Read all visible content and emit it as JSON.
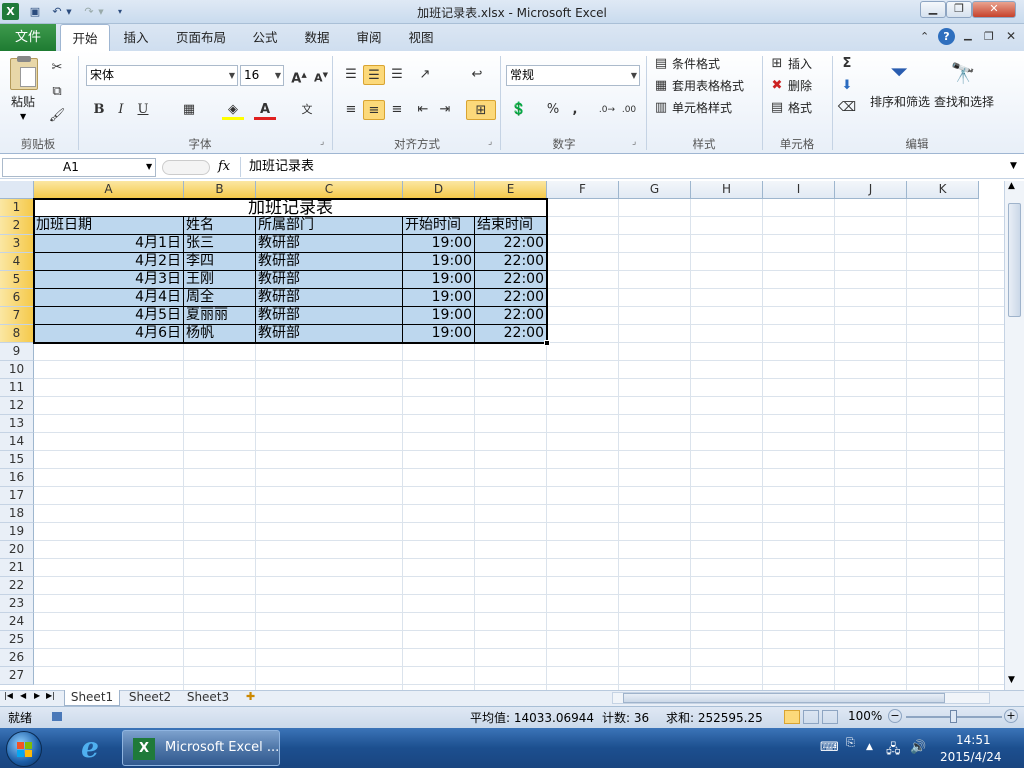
{
  "window": {
    "title": "加班记录表.xlsx - Microsoft Excel"
  },
  "ribbon": {
    "file_tab": "文件",
    "tabs": [
      "开始",
      "插入",
      "页面布局",
      "公式",
      "数据",
      "审阅",
      "视图"
    ],
    "font_name": "宋体",
    "font_size": "16",
    "number_format": "常规",
    "paste_label": "粘贴",
    "cond_format": "条件格式",
    "table_format": "套用表格格式",
    "cell_styles": "单元格样式",
    "insert": "插入",
    "delete": "删除",
    "format": "格式",
    "sort_filter": "排序和筛选",
    "find_select": "查找和选择",
    "groups": [
      "剪贴板",
      "字体",
      "对齐方式",
      "数字",
      "样式",
      "单元格",
      "编辑"
    ]
  },
  "formula_bar": {
    "name_box": "A1",
    "fx": "fx",
    "content": "加班记录表"
  },
  "sheet": {
    "columns": [
      "A",
      "B",
      "C",
      "D",
      "E",
      "F",
      "G",
      "H",
      "I",
      "J",
      "K"
    ],
    "title": "加班记录表",
    "headers": [
      "加班日期",
      "姓名",
      "所属部门",
      "开始时间",
      "结束时间"
    ],
    "rows": [
      [
        "4月1日",
        "张三",
        "教研部",
        "19:00",
        "22:00"
      ],
      [
        "4月2日",
        "李四",
        "教研部",
        "19:00",
        "22:00"
      ],
      [
        "4月3日",
        "王刚",
        "教研部",
        "19:00",
        "22:00"
      ],
      [
        "4月4日",
        "周全",
        "教研部",
        "19:00",
        "22:00"
      ],
      [
        "4月5日",
        "夏丽丽",
        "教研部",
        "19:00",
        "22:00"
      ],
      [
        "4月6日",
        "杨帆",
        "教研部",
        "19:00",
        "22:00"
      ]
    ],
    "row_numbers": [
      "1",
      "2",
      "3",
      "4",
      "5",
      "6",
      "7",
      "8",
      "9",
      "10",
      "11",
      "12",
      "13",
      "14",
      "15",
      "16",
      "17",
      "18",
      "19",
      "20",
      "21",
      "22",
      "23",
      "24",
      "25",
      "26",
      "27"
    ]
  },
  "sheet_tabs": [
    "Sheet1",
    "Sheet2",
    "Sheet3"
  ],
  "status": {
    "ready": "就绪",
    "average": "平均值: 14033.06944",
    "count": "计数: 36",
    "sum": "求和: 252595.25",
    "zoom": "100%"
  },
  "taskbar": {
    "app": "Microsoft Excel ...",
    "time": "14:51",
    "date": "2015/4/24"
  }
}
